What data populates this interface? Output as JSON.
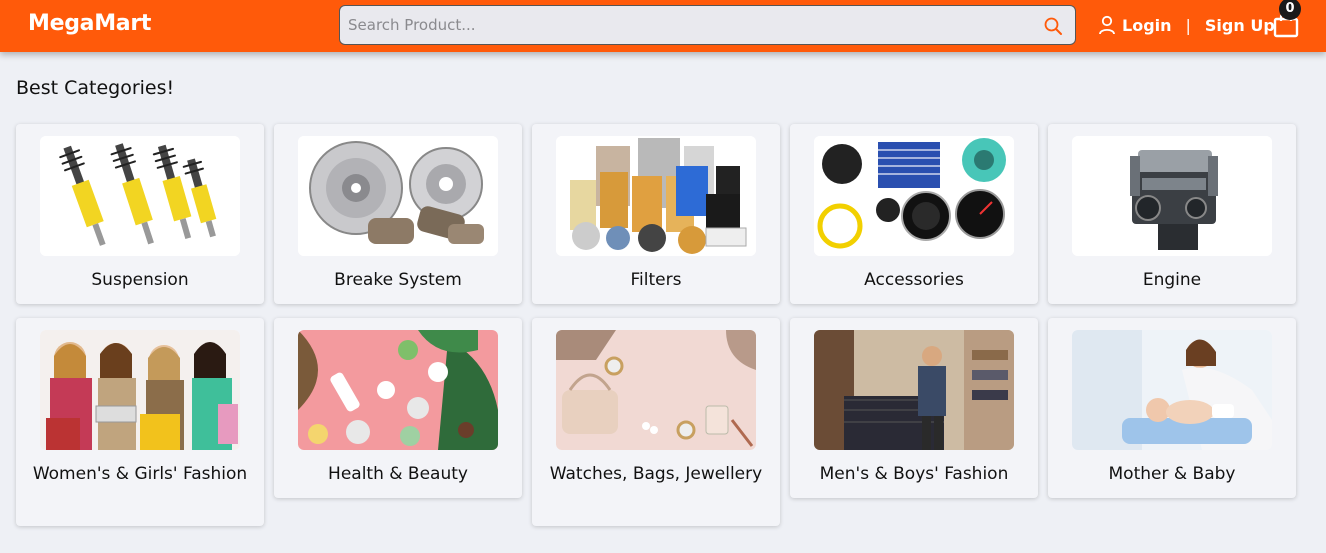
{
  "header": {
    "brand": "MegaMart",
    "search_placeholder": "Search Product...",
    "login_label": "Login",
    "separator": "|",
    "signup_label": "Sign Up",
    "cart_count": "0",
    "accent_color": "#ff5a0a"
  },
  "section": {
    "title": "Best Categories!"
  },
  "categories": [
    {
      "label": "Suspension",
      "icon": "suspension-image"
    },
    {
      "label": "Breake System",
      "icon": "brake-system-image"
    },
    {
      "label": "Filters",
      "icon": "filters-image"
    },
    {
      "label": "Accessories",
      "icon": "accessories-image"
    },
    {
      "label": "Engine",
      "icon": "engine-image"
    },
    {
      "label": "Women's & Girls' Fashion",
      "icon": "womens-fashion-image"
    },
    {
      "label": "Health & Beauty",
      "icon": "health-beauty-image"
    },
    {
      "label": "Watches, Bags, Jewellery",
      "icon": "watches-bags-image"
    },
    {
      "label": "Men's & Boys' Fashion",
      "icon": "mens-fashion-image"
    },
    {
      "label": "Mother & Baby",
      "icon": "mother-baby-image"
    }
  ]
}
